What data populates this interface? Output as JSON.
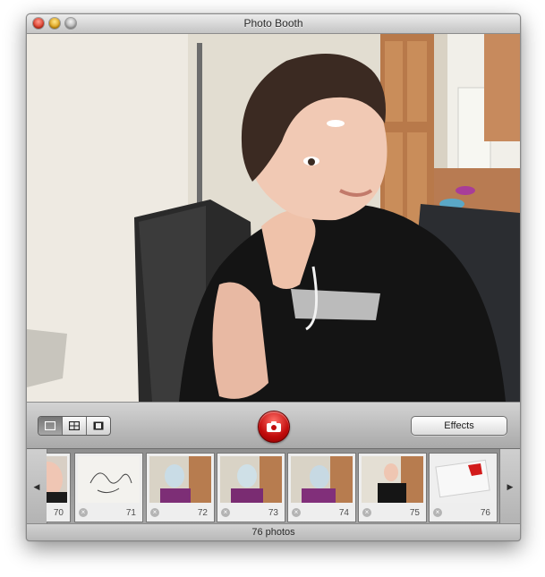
{
  "window": {
    "title": "Photo Booth"
  },
  "controls": {
    "view_modes": [
      "single-photo-icon",
      "four-up-icon",
      "movie-clip-icon"
    ],
    "selected_view": "single-photo-icon",
    "snapshot_icon": "camera-icon",
    "effects_label": "Effects"
  },
  "strip": {
    "left_arrow": "◀",
    "right_arrow": "▶",
    "delete_glyph": "×",
    "thumbnails": [
      {
        "number": "70"
      },
      {
        "number": "71"
      },
      {
        "number": "72"
      },
      {
        "number": "73"
      },
      {
        "number": "74"
      },
      {
        "number": "75"
      },
      {
        "number": "76"
      }
    ]
  },
  "status": {
    "count_label": "76 photos"
  },
  "colors": {
    "snapshot_red": "#d11414",
    "window_gray": "#d9d9d9"
  }
}
